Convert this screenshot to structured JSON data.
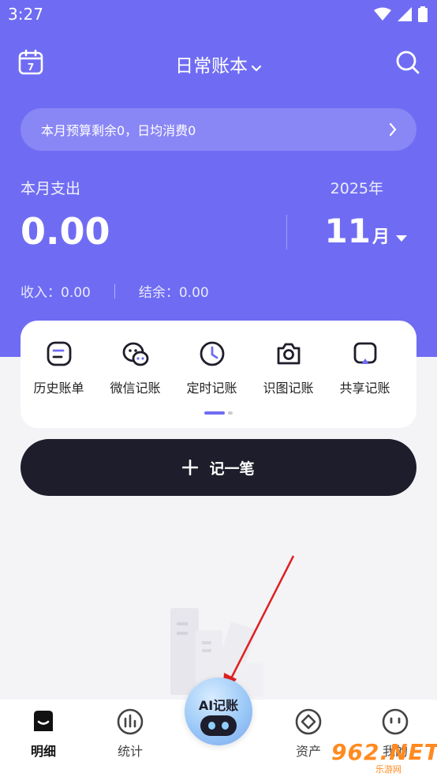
{
  "status_bar": {
    "time": "3:27"
  },
  "header": {
    "title": "日常账本",
    "calendar_day": "7"
  },
  "budget": {
    "text": "本月预算剩余0，日均消费0"
  },
  "summary": {
    "expense_label": "本月支出",
    "expense_value": "0.00",
    "year": "2025年",
    "month_num": "11",
    "month_unit": "月",
    "income_text": "收入：0.00",
    "balance_text": "结余：0.00"
  },
  "quick_actions": [
    {
      "label": "历史账单",
      "icon": "history-bill-icon"
    },
    {
      "label": "微信记账",
      "icon": "wechat-icon"
    },
    {
      "label": "定时记账",
      "icon": "clock-icon"
    },
    {
      "label": "识图记账",
      "icon": "camera-icon"
    },
    {
      "label": "共享记账",
      "icon": "share-icon"
    }
  ],
  "add_button": {
    "label": "记一笔"
  },
  "ai_button": {
    "label": "AI记账"
  },
  "nav": {
    "tabs": [
      {
        "label": "明细",
        "icon": "detail-icon",
        "active": true
      },
      {
        "label": "统计",
        "icon": "stats-icon",
        "active": false
      },
      {
        "label": "资产",
        "icon": "assets-icon",
        "active": false
      },
      {
        "label": "我的",
        "icon": "profile-icon",
        "active": false
      }
    ]
  },
  "watermark": {
    "brand": "962.NET",
    "sub": "乐游网"
  },
  "colors": {
    "primary": "#6f6cf3",
    "dark": "#1d1d2b",
    "background": "#f4f4f7"
  }
}
